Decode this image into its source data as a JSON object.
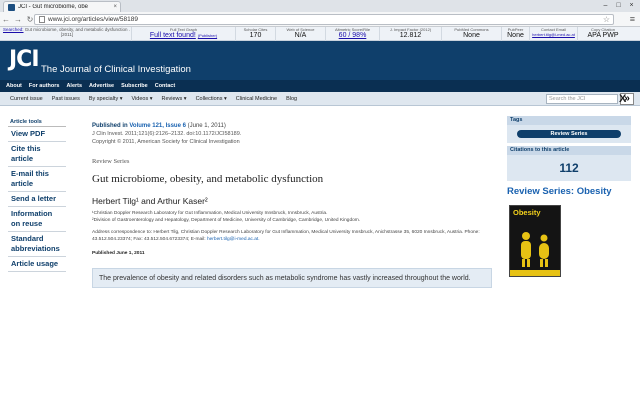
{
  "browser": {
    "tab_title": "JCI - Gut microbiome, obe",
    "tab_close": "×",
    "url": "www.jci.org/articles/view/58189",
    "window_controls": [
      "–",
      "□",
      "×"
    ]
  },
  "extension_bar": {
    "search_label": "Searched:",
    "search_text": "Gut microbiome, obesity, and metabolic dysfunction .",
    "search_year": "[2011]",
    "fulltext_label": "Full Text Graph",
    "fulltext_value": "Full text found!",
    "fulltext_sub": "(Publisher)",
    "scholar_label": "Scholar Cites",
    "scholar_value": "170",
    "wos_label": "Web of Science",
    "wos_value": "N/A",
    "altmetric_label": "Altmetric Score/Rile",
    "altmetric_value": "60 / 98%",
    "impact_label": "J. Impact Factor (2012)",
    "impact_value": "12.812",
    "pmc_label": "PubMed Commons",
    "pmc_value": "None",
    "pubpeer_label": "PubPeer",
    "pubpeer_value": "None",
    "contact_label": "Contact Email",
    "contact_value": "herbert.tilg@i-med.ac.at",
    "copy_label": "Copy Citation",
    "copy_value": "APA PWP"
  },
  "jci": {
    "logo": "JCI",
    "full_name": "The Journal of Clinical Investigation",
    "nav": [
      "About",
      "For authors",
      "Alerts",
      "Advertise",
      "Subscribe",
      "Contact"
    ],
    "subnav": [
      "Current issue",
      "Past issues",
      "By specialty ▾",
      "Videos ▾",
      "Reviews ▾",
      "Collections ▾",
      "Clinical Medicine",
      "Blog"
    ],
    "search_placeholder": "Search the JCI",
    "search_go": "»",
    "close": "X"
  },
  "article_tools": {
    "header": "Article tools",
    "items": [
      "View PDF",
      "Cite this article",
      "E-mail this article",
      "Send a letter",
      "Information on reuse",
      "Standard abbreviations",
      "Article usage"
    ]
  },
  "article": {
    "published_in": "Published in",
    "volume": "Volume 121, Issue 6",
    "date_paren": "(June 1, 2011)",
    "citation": "J Clin Invest. 2011;121(6):2126–2132. doi:10.1172/JCI58189.",
    "copyright": "Copyright © 2011, American Society for Clinical Investigation",
    "series": "Review Series",
    "title": "Gut microbiome, obesity, and metabolic dysfunction",
    "authors": "Herbert Tilg¹ and Arthur Kaser²",
    "affil1": "¹Christian Doppler Research Laboratory for Gut Inflammation, Medical University Innsbruck, Innsbruck, Austria.",
    "affil2": "²Division of Gastroenterology and Hepatology, Department of Medicine, University of Cambridge, Cambridge, United Kingdom.",
    "address": "Address correspondence to: Herbert Tilg, Christian Doppler Research Laboratory for Gut Inflammation, Medical University Innsbruck, Anichstrasse 35, 6020 Innsbruck, Austria. Phone: 43.512.504.23374; Fax: 43.512.504.6723374; E-mail:",
    "email": "herbert.tilg@i-med.ac.at.",
    "published_date": "Published June 1, 2011",
    "abstract_start": "The prevalence of obesity and related disorders such as metabolic syndrome has vastly increased throughout the world."
  },
  "right": {
    "tags_header": "Tags",
    "tag_pill": "Review Series",
    "citations_header": "Citations to this article",
    "citations_count": "112",
    "review_series_title": "Review Series: Obesity",
    "cover_title": "Obesity"
  },
  "colors": {
    "brand": "#0f3f6b",
    "link": "#1a62b0"
  }
}
